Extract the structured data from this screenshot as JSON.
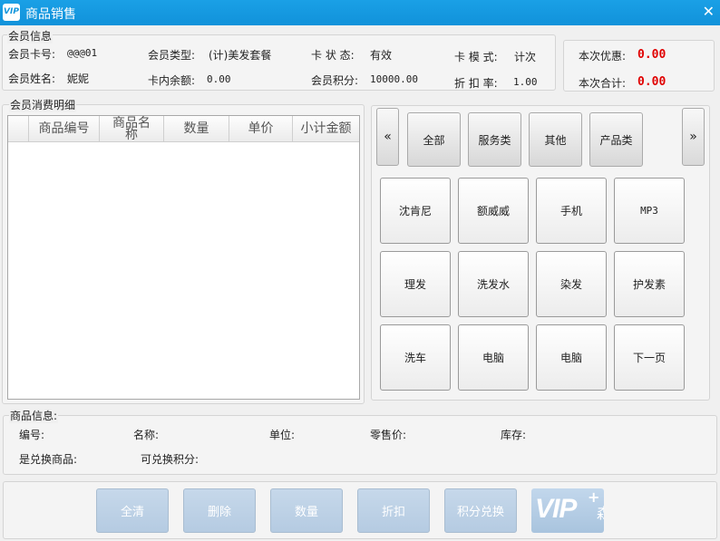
{
  "window": {
    "title": "商品销售",
    "logo_text": "VIP"
  },
  "member_info": {
    "legend": "会员信息",
    "card_no_label": "会员卡号:",
    "card_no_value": "@@@01",
    "type_label": "会员类型:",
    "type_value": "(计)美发套餐",
    "status_label": "卡 状 态:",
    "status_value": "有效",
    "mode_label": "卡 模 式:",
    "mode_value": "计次",
    "name_label": "会员姓名:",
    "name_value": "妮妮",
    "balance_label": "卡内余额:",
    "balance_value": "0.00",
    "points_label": "会员积分:",
    "points_value": "10000.00",
    "discount_label": "折 扣 率:",
    "discount_value": "1.00"
  },
  "summary": {
    "discount_label": "本次优惠:",
    "discount_value": "0.00",
    "total_label": "本次合计:",
    "total_value": "0.00"
  },
  "detail": {
    "legend": "会员消费明细",
    "columns": [
      "商品编号",
      "商品名称",
      "数量",
      "单价",
      "小计金额"
    ]
  },
  "categories": {
    "prev": "«",
    "next": "»",
    "items": [
      "全部",
      "服务类",
      "其他",
      "产品类"
    ]
  },
  "products": [
    "沈肯尼",
    "额威威",
    "手机",
    "MP3",
    "理发",
    "洗发水",
    "染发",
    "护发素",
    "洗车",
    "电脑",
    "电脑",
    "下一页"
  ],
  "product_info": {
    "legend": "商品信息:",
    "code_label": "编号:",
    "name_label": "名称:",
    "unit_label": "单位:",
    "price_label": "零售价:",
    "stock_label": "库存:",
    "exchange_label": "是兑换商品:",
    "exchange_points_label": "可兑换积分:"
  },
  "actions": [
    "全清",
    "删除",
    "数量",
    "折扣",
    "积分兑换"
  ],
  "brand": {
    "vip_text": "VIP",
    "plus": "+",
    "partial_text": "森"
  }
}
